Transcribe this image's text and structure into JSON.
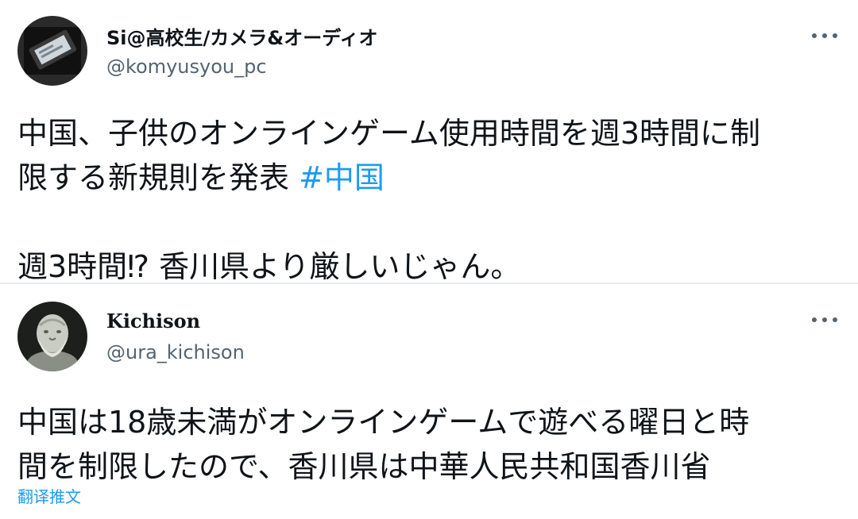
{
  "tweets": [
    {
      "display_name": "Si@高校生/カメラ&オーディオ",
      "handle": "@komyusyou_pc",
      "text_line1": "中国、子供のオンラインゲーム使用時間を週3時間に制",
      "text_line2_prefix": "限する新規則を発表 ",
      "hashtag": "#中国",
      "text_line3": "",
      "text_line4": "週3時間⁉ 香川県より厳しいじゃん。"
    },
    {
      "display_name": "Kichison",
      "handle": "@ura_kichison",
      "text_line1": "中国は18歳未満がオンラインゲームで遊べる曜日と時",
      "text_line2": "間を制限したので、香川県は中華人民共和国香川省",
      "translate_label": "翻译推文"
    }
  ],
  "icons": {
    "more": "more-horizontal-icon"
  },
  "colors": {
    "link": "#1d9bf0",
    "secondary": "#536471",
    "text": "#0f1419",
    "divider": "#e6ecf0"
  }
}
